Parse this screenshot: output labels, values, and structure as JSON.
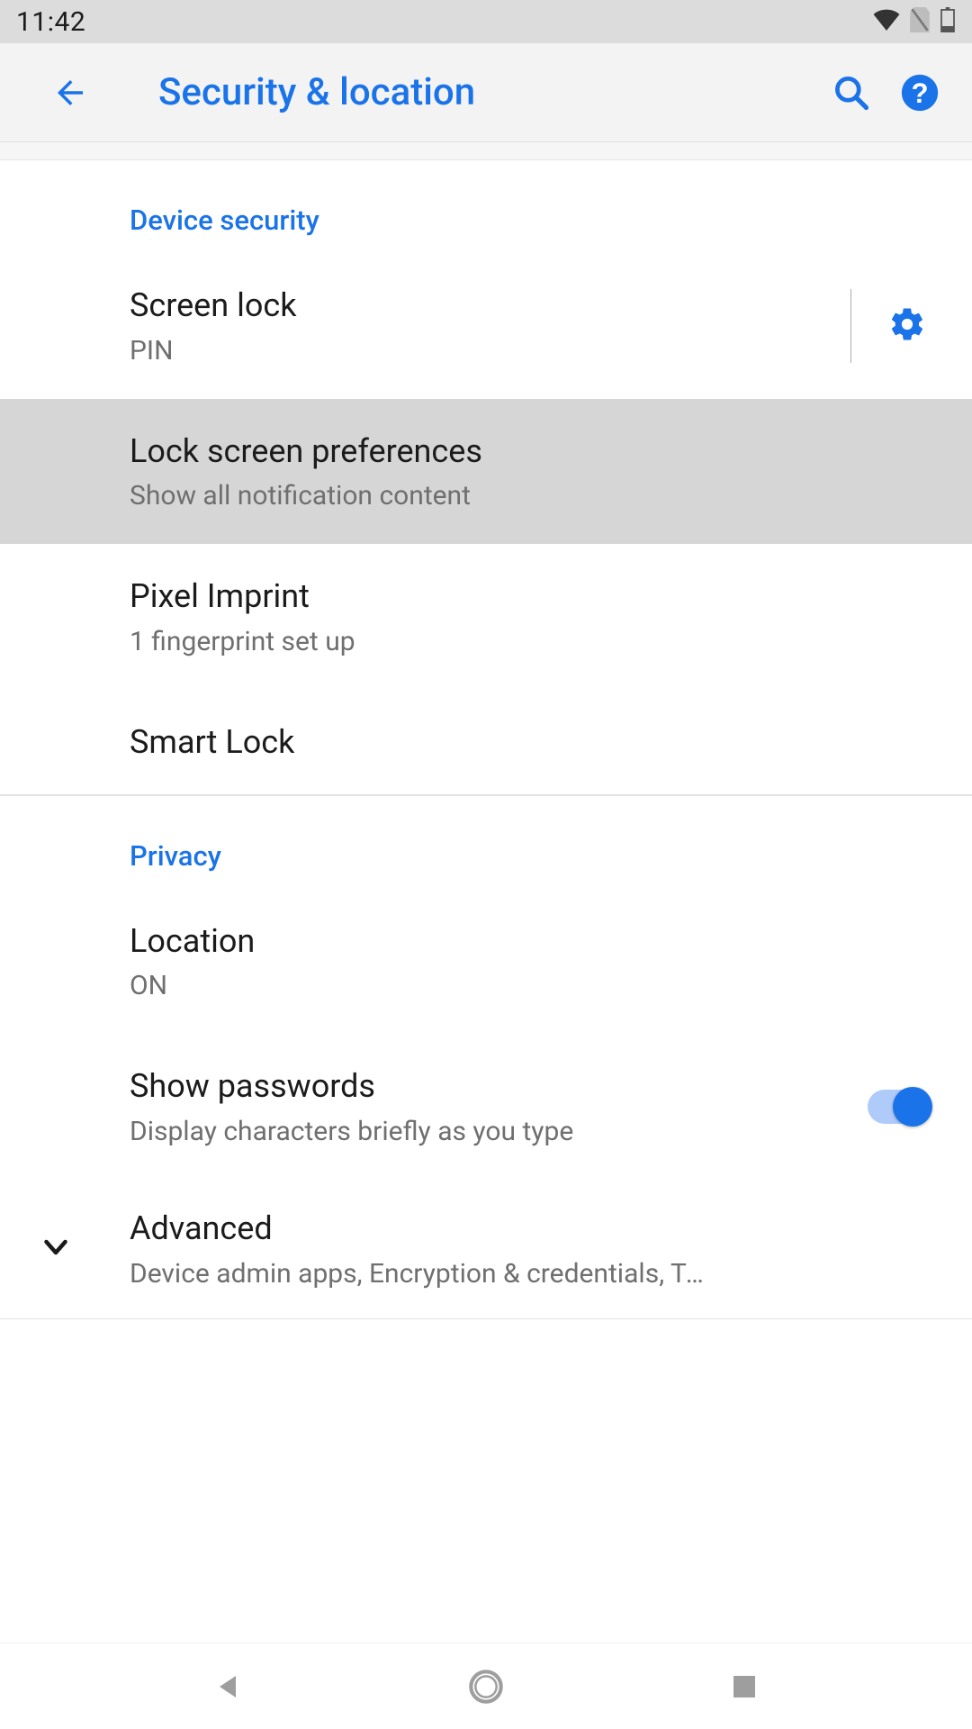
{
  "status": {
    "time": "11:42"
  },
  "colors": {
    "accent": "#1a73e8"
  },
  "header": {
    "title": "Security & location"
  },
  "sections": {
    "device_security": {
      "label": "Device security",
      "screen_lock": {
        "title": "Screen lock",
        "sub": "PIN"
      },
      "lock_prefs": {
        "title": "Lock screen preferences",
        "sub": "Show all notification content"
      },
      "pixel_imprint": {
        "title": "Pixel Imprint",
        "sub": "1 fingerprint set up"
      },
      "smart_lock": {
        "title": "Smart Lock"
      }
    },
    "privacy": {
      "label": "Privacy",
      "location": {
        "title": "Location",
        "sub": "ON"
      },
      "show_passwords": {
        "title": "Show passwords",
        "sub": "Display characters briefly as you type",
        "switch": true
      },
      "advanced": {
        "title": "Advanced",
        "sub": "Device admin apps, Encryption & credentials, Trust.."
      }
    }
  }
}
